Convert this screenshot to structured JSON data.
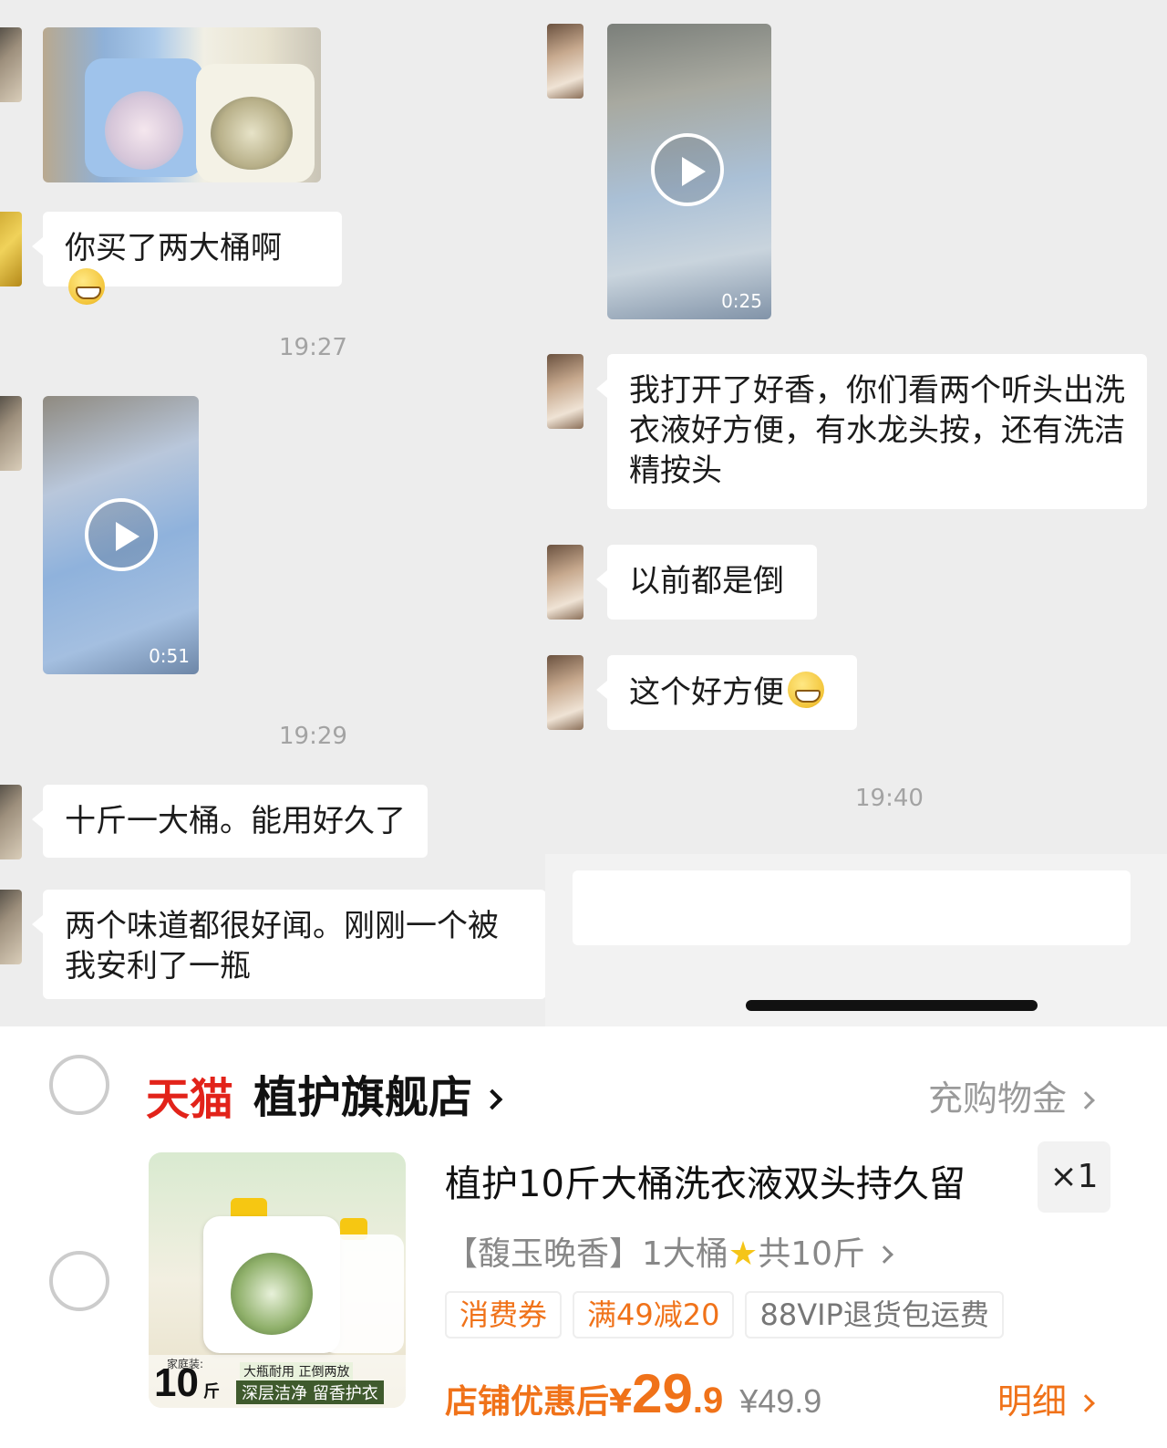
{
  "chat": {
    "left": {
      "msg_two_buckets": "你买了两大桶啊",
      "time1": "19:27",
      "video1_duration": "0:51",
      "time2": "19:29",
      "msg_ten_jin": "十斤一大桶。能用好久了",
      "msg_both_smell": "两个味道都很好闻。刚刚一个被我安利了一瓶"
    },
    "right": {
      "video2_duration": "0:25",
      "msg_opened": "我打开了好香，你们看两个听头出洗衣液好方便，有水龙头按，还有洗洁精按头",
      "msg_before": "以前都是倒",
      "msg_convenient": "这个好方便",
      "time3": "19:40"
    }
  },
  "shop": {
    "platform": "天猫",
    "store_name": "植护旗舰店",
    "recharge_label": "充购物金",
    "product": {
      "title": "植护10斤大桶洗衣液双头持久留",
      "quantity": "×1",
      "sku_prefix": "【馥玉晚香】1大桶",
      "sku_suffix": "共10斤",
      "tags": [
        "消费券",
        "满49减20",
        "88VIP退货包运费"
      ],
      "after_discount_label": "店铺优惠后",
      "price_symbol": "¥",
      "price_int": "29",
      "price_dec": ".9",
      "original_price": "¥49.9",
      "detail_label": "明细",
      "image_text": {
        "family": "家庭装:",
        "big": "10",
        "jin": "斤",
        "sub1": "大瓶耐用 正倒两放",
        "sub2": "深层洁净 留香护衣"
      }
    }
  },
  "colors": {
    "chat_bg": "#ededed",
    "tmall_red": "#e2231a",
    "accent_orange": "#f07219"
  }
}
